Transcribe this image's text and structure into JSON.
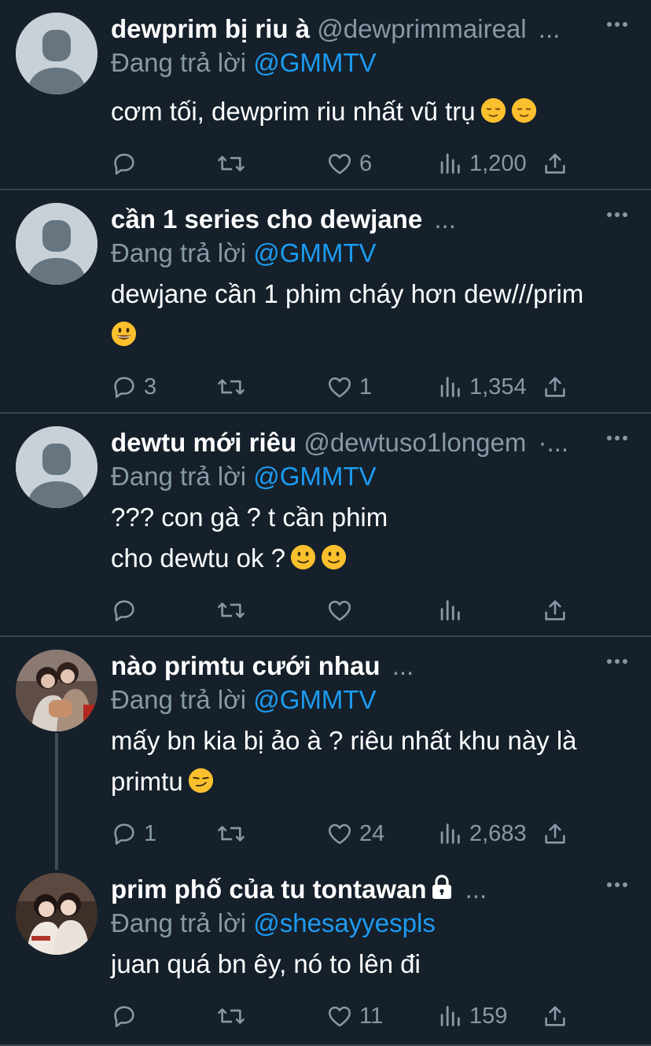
{
  "tweets": [
    {
      "name": "dewprim bị riu à",
      "handle": "@dewprimmaireal",
      "dots": "...",
      "reply_label": "Đang trả lời",
      "reply_to": "@GMMTV",
      "lines": [
        "cơm tối, dewprim riu nhất vũ trụ"
      ],
      "emojis": [
        "relieved-face",
        "relieved-face"
      ],
      "replies": "",
      "retweets": "",
      "likes": "6",
      "views": "1,200",
      "avatar": "default"
    },
    {
      "name": "cần 1 series cho dewjane",
      "handle": "",
      "dots": "...",
      "reply_label": "Đang trả lời",
      "reply_to": "@GMMTV",
      "lines": [
        "dewjane cần 1 phim cháy hơn dew///prim"
      ],
      "emojis": [
        "grinning-face"
      ],
      "replies": "3",
      "retweets": "",
      "likes": "1",
      "views": "1,354",
      "avatar": "default"
    },
    {
      "name": "dewtu mới riêu",
      "handle": "@dewtuso1longem",
      "dots": "·...",
      "reply_label": "Đang trả lời",
      "reply_to": "@GMMTV",
      "lines": [
        "??? con gà ? t cần phim",
        "cho dewtu ok ?"
      ],
      "emojis": [
        "slightly-smiling-face",
        "slightly-smiling-face"
      ],
      "replies": "",
      "retweets": "",
      "likes": "",
      "views": "",
      "avatar": "default"
    },
    {
      "name": "nào primtu cưới nhau",
      "handle": "",
      "dots": "...",
      "reply_label": "Đang trả lời",
      "reply_to": "@GMMTV",
      "lines": [
        "mấy bn kia bị ảo à ? riêu nhất khu này là",
        "primtu"
      ],
      "emojis": [
        "smirking-face"
      ],
      "replies": "1",
      "retweets": "",
      "likes": "24",
      "views": "2,683",
      "avatar": "photo"
    },
    {
      "name": "prim phố của tu tontawan",
      "handle": "",
      "dots": "...",
      "reply_label": "Đang trả lời",
      "reply_to": "@shesayyespls",
      "lines": [
        "juan quá bn êy, nó to lên đi"
      ],
      "emojis": [],
      "replies": "",
      "retweets": "",
      "likes": "11",
      "views": "159",
      "avatar": "photo2",
      "protected": true
    }
  ],
  "icons": {
    "reply": "reply-icon",
    "retweet": "retweet-icon",
    "like": "heart-icon",
    "views": "views-icon",
    "share": "share-icon",
    "more": "more-icon",
    "lock": "lock-icon"
  },
  "colors": {
    "background": "#15202b",
    "divider": "#38444d",
    "secondary_text": "#8899a6",
    "link": "#1d9bf0"
  }
}
